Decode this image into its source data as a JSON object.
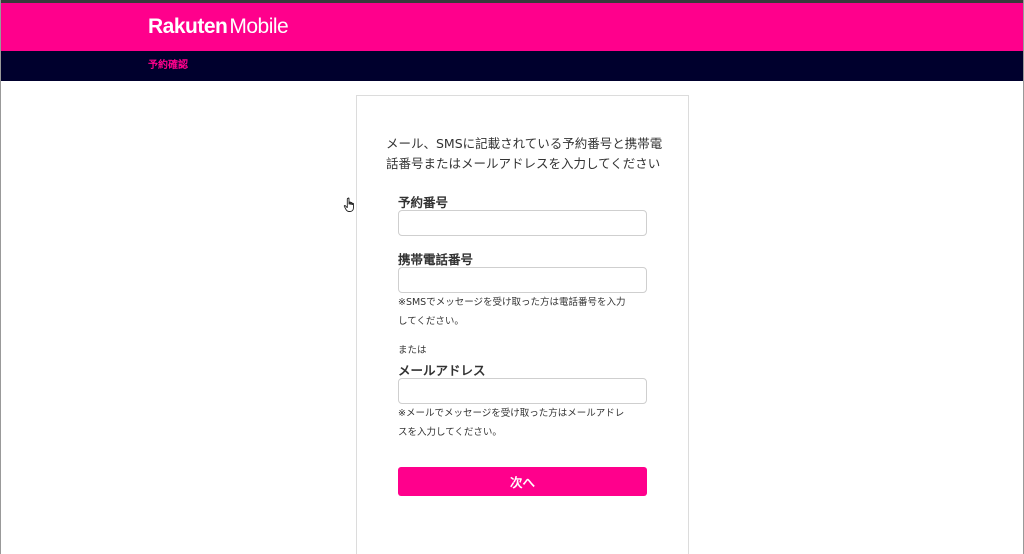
{
  "header": {
    "logo_brand": "Rakuten",
    "logo_product": "Mobile",
    "brand_color": "#ff008c",
    "nav_color": "#00002d"
  },
  "subnav": {
    "item_label": "予約確認"
  },
  "form": {
    "intro": "メール、SMSに記載されている予約番号と携帯電話番号またはメールアドレスを入力してください",
    "reservation_number": {
      "label": "予約番号",
      "value": "",
      "placeholder": ""
    },
    "phone_number": {
      "label": "携帯電話番号",
      "value": "",
      "placeholder": "",
      "note": "※SMSでメッセージを受け取った方は電話番号を入力してください。"
    },
    "or_label": "または",
    "email": {
      "label": "メールアドレス",
      "value": "",
      "placeholder": "",
      "note": "※メールでメッセージを受け取った方はメールアドレスを入力してください。"
    },
    "next_button_label": "次へ"
  },
  "cursor": {
    "icon": "hand-pointer-icon"
  }
}
